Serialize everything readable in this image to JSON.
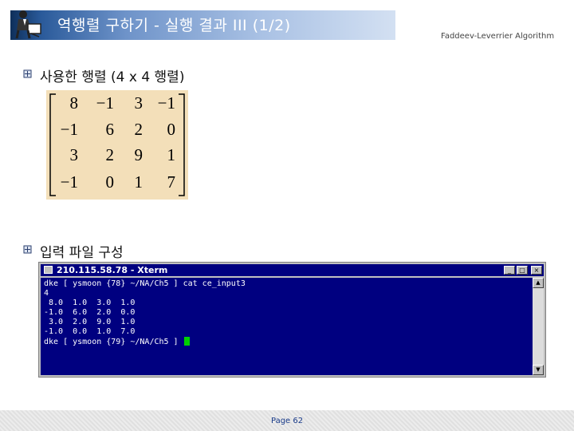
{
  "header": {
    "title": "역행렬 구하기 - 실행 결과 III (1/2)",
    "subtitle": "Faddeev-Leverrier Algorithm"
  },
  "sections": [
    {
      "heading": "사용한 행렬 (4 x 4 행렬)"
    },
    {
      "heading": "입력 파일 구성"
    }
  ],
  "matrix": {
    "rows": [
      [
        "8",
        "−1",
        "3",
        "−1"
      ],
      [
        "−1",
        "6",
        "2",
        "0"
      ],
      [
        "3",
        "2",
        "9",
        "1"
      ],
      [
        "−1",
        "0",
        "1",
        "7"
      ]
    ]
  },
  "terminal": {
    "title": "210.115.58.78 - Xterm",
    "lines": [
      "dke [ ysmoon {78} ~/NA/Ch5 ] cat ce_input3",
      "4",
      " 8.0  1.0  3.0  1.0",
      "-1.0  6.0  2.0  0.0",
      " 3.0  2.0  9.0  1.0",
      "-1.0  0.0  1.0  7.0",
      "dke [ ysmoon {79} ~/NA/Ch5 ] "
    ]
  },
  "footer": {
    "page": "Page 62"
  }
}
